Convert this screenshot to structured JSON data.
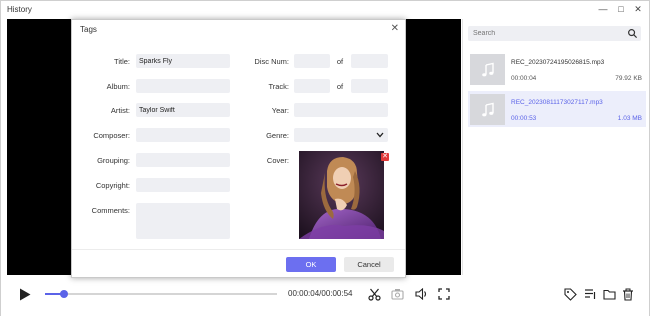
{
  "window": {
    "title": "History",
    "min_icon": "minimize-icon",
    "max_icon": "maximize-icon",
    "close_icon": "close-icon"
  },
  "search": {
    "placeholder": "Search"
  },
  "history": [
    {
      "name": "REC_20230724195026815.mp3",
      "duration": "00:00:04",
      "size": "79.92 KB",
      "selected": false
    },
    {
      "name": "REC_20230811173027117.mp3",
      "duration": "00:00:53",
      "size": "1.03 MB",
      "selected": true
    }
  ],
  "player": {
    "timecode": "00:00:04/00:00:54",
    "progress": 0.08
  },
  "dialog": {
    "title": "Tags",
    "labels": {
      "title": "Title:",
      "album": "Album:",
      "artist": "Artist:",
      "composer": "Composer:",
      "grouping": "Grouping:",
      "copyright": "Copyright:",
      "comments": "Comments:",
      "disc": "Disc Num:",
      "track": "Track:",
      "year": "Year:",
      "genre": "Genre:",
      "cover": "Cover:",
      "of": "of"
    },
    "values": {
      "title": "Sparks Fly",
      "album": "",
      "artist": "Taylor Swift",
      "composer": "",
      "grouping": "",
      "copyright": "",
      "comments": "",
      "disc_num": "",
      "disc_of": "",
      "track_num": "",
      "track_of": "",
      "year": "",
      "genre": ""
    },
    "ok": "OK",
    "cancel": "Cancel"
  },
  "colors": {
    "accent": "#5b63e8",
    "video_bg": "#000000",
    "field_bg": "#eeeff3",
    "ok_button": "#6c6ff0"
  }
}
